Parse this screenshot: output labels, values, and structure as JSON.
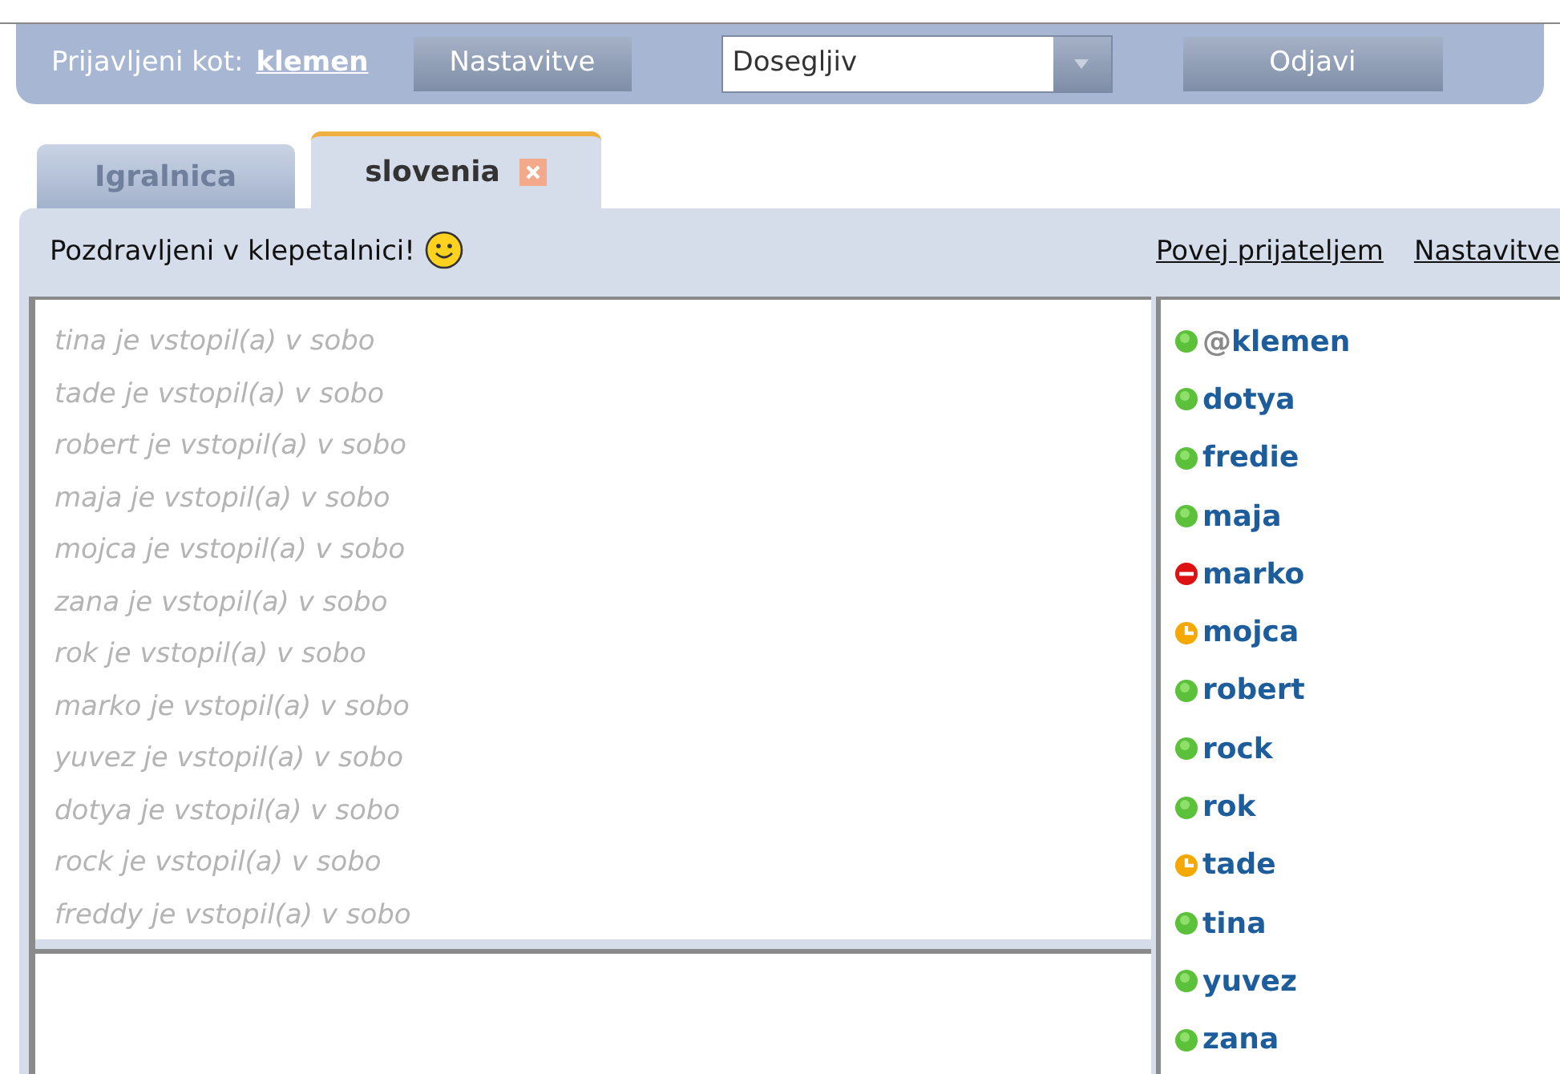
{
  "top_bar": {
    "logged_in_label": "Prijavljeni kot:",
    "username": "klemen",
    "settings_button": "Nastavitve",
    "status_select": {
      "value": "Dosegljiv"
    },
    "logout_button": "Odjavi"
  },
  "tabs": [
    {
      "label": "Igralnica",
      "selected": false,
      "closable": false
    },
    {
      "label": "slovenia",
      "selected": true,
      "closable": true
    }
  ],
  "room": {
    "welcome": "Pozdravljeni v klepetalnici!",
    "links": [
      "Povej prijateljem",
      "Nastavitve"
    ],
    "messages": [
      "tina je vstopil(a) v sobo",
      "tade je vstopil(a) v sobo",
      "robert je vstopil(a) v sobo",
      "maja je vstopil(a) v sobo",
      "mojca je vstopil(a) v sobo",
      "zana je vstopil(a) v sobo",
      "rok je vstopil(a) v sobo",
      "marko je vstopil(a) v sobo",
      "yuvez je vstopil(a) v sobo",
      "dotya je vstopil(a) v sobo",
      "rock je vstopil(a) v sobo",
      "freddy je vstopil(a) v sobo"
    ],
    "users": [
      {
        "prefix": "@",
        "name": "klemen",
        "kind": "online"
      },
      {
        "name": "dotya",
        "kind": "online"
      },
      {
        "name": "fredie",
        "kind": "online"
      },
      {
        "name": "maja",
        "kind": "online"
      },
      {
        "name": "marko",
        "kind": "busy"
      },
      {
        "name": "mojca",
        "kind": "away"
      },
      {
        "name": "robert",
        "kind": "online"
      },
      {
        "name": "rock",
        "kind": "online"
      },
      {
        "name": "rok",
        "kind": "online"
      },
      {
        "name": "tade",
        "kind": "away"
      },
      {
        "name": "tina",
        "kind": "online"
      },
      {
        "name": "yuvez",
        "kind": "online"
      },
      {
        "name": "zana",
        "kind": "online"
      }
    ]
  }
}
